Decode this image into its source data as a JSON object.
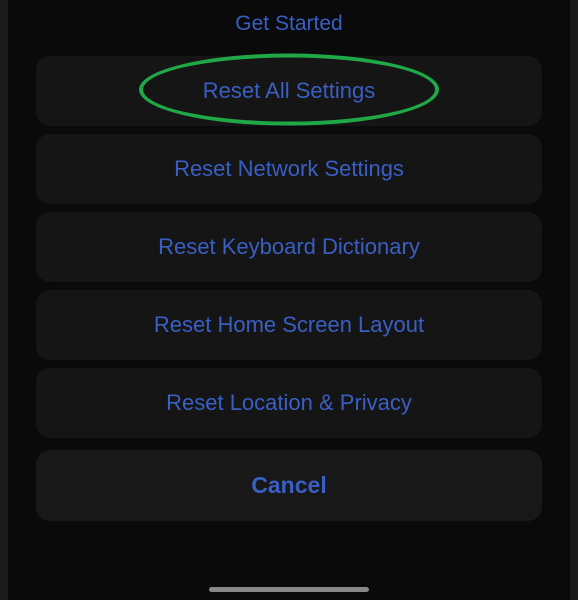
{
  "header": {
    "title": "Get Started"
  },
  "actions": {
    "reset_all": "Reset All Settings",
    "reset_network": "Reset Network Settings",
    "reset_keyboard": "Reset Keyboard Dictionary",
    "reset_home": "Reset Home Screen Layout",
    "reset_location": "Reset Location & Privacy",
    "cancel": "Cancel"
  },
  "highlight": {
    "target": "reset_all",
    "color": "#1fa845"
  }
}
